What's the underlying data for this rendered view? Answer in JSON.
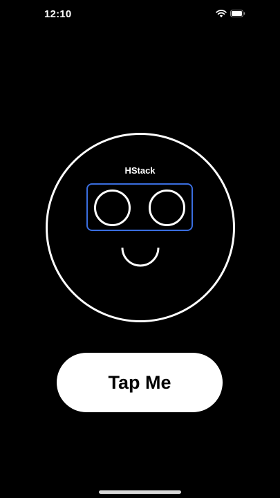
{
  "status_bar": {
    "time": "12:10",
    "icons": [
      "wifi-icon",
      "battery-icon"
    ]
  },
  "face": {
    "hstack_label": "HStack",
    "outline_color": "#ffffff",
    "hstack_border_color": "#3a6ee0"
  },
  "button": {
    "label": "Tap Me",
    "background": "#ffffff",
    "text_color": "#000000"
  },
  "theme": {
    "background": "#000000"
  }
}
